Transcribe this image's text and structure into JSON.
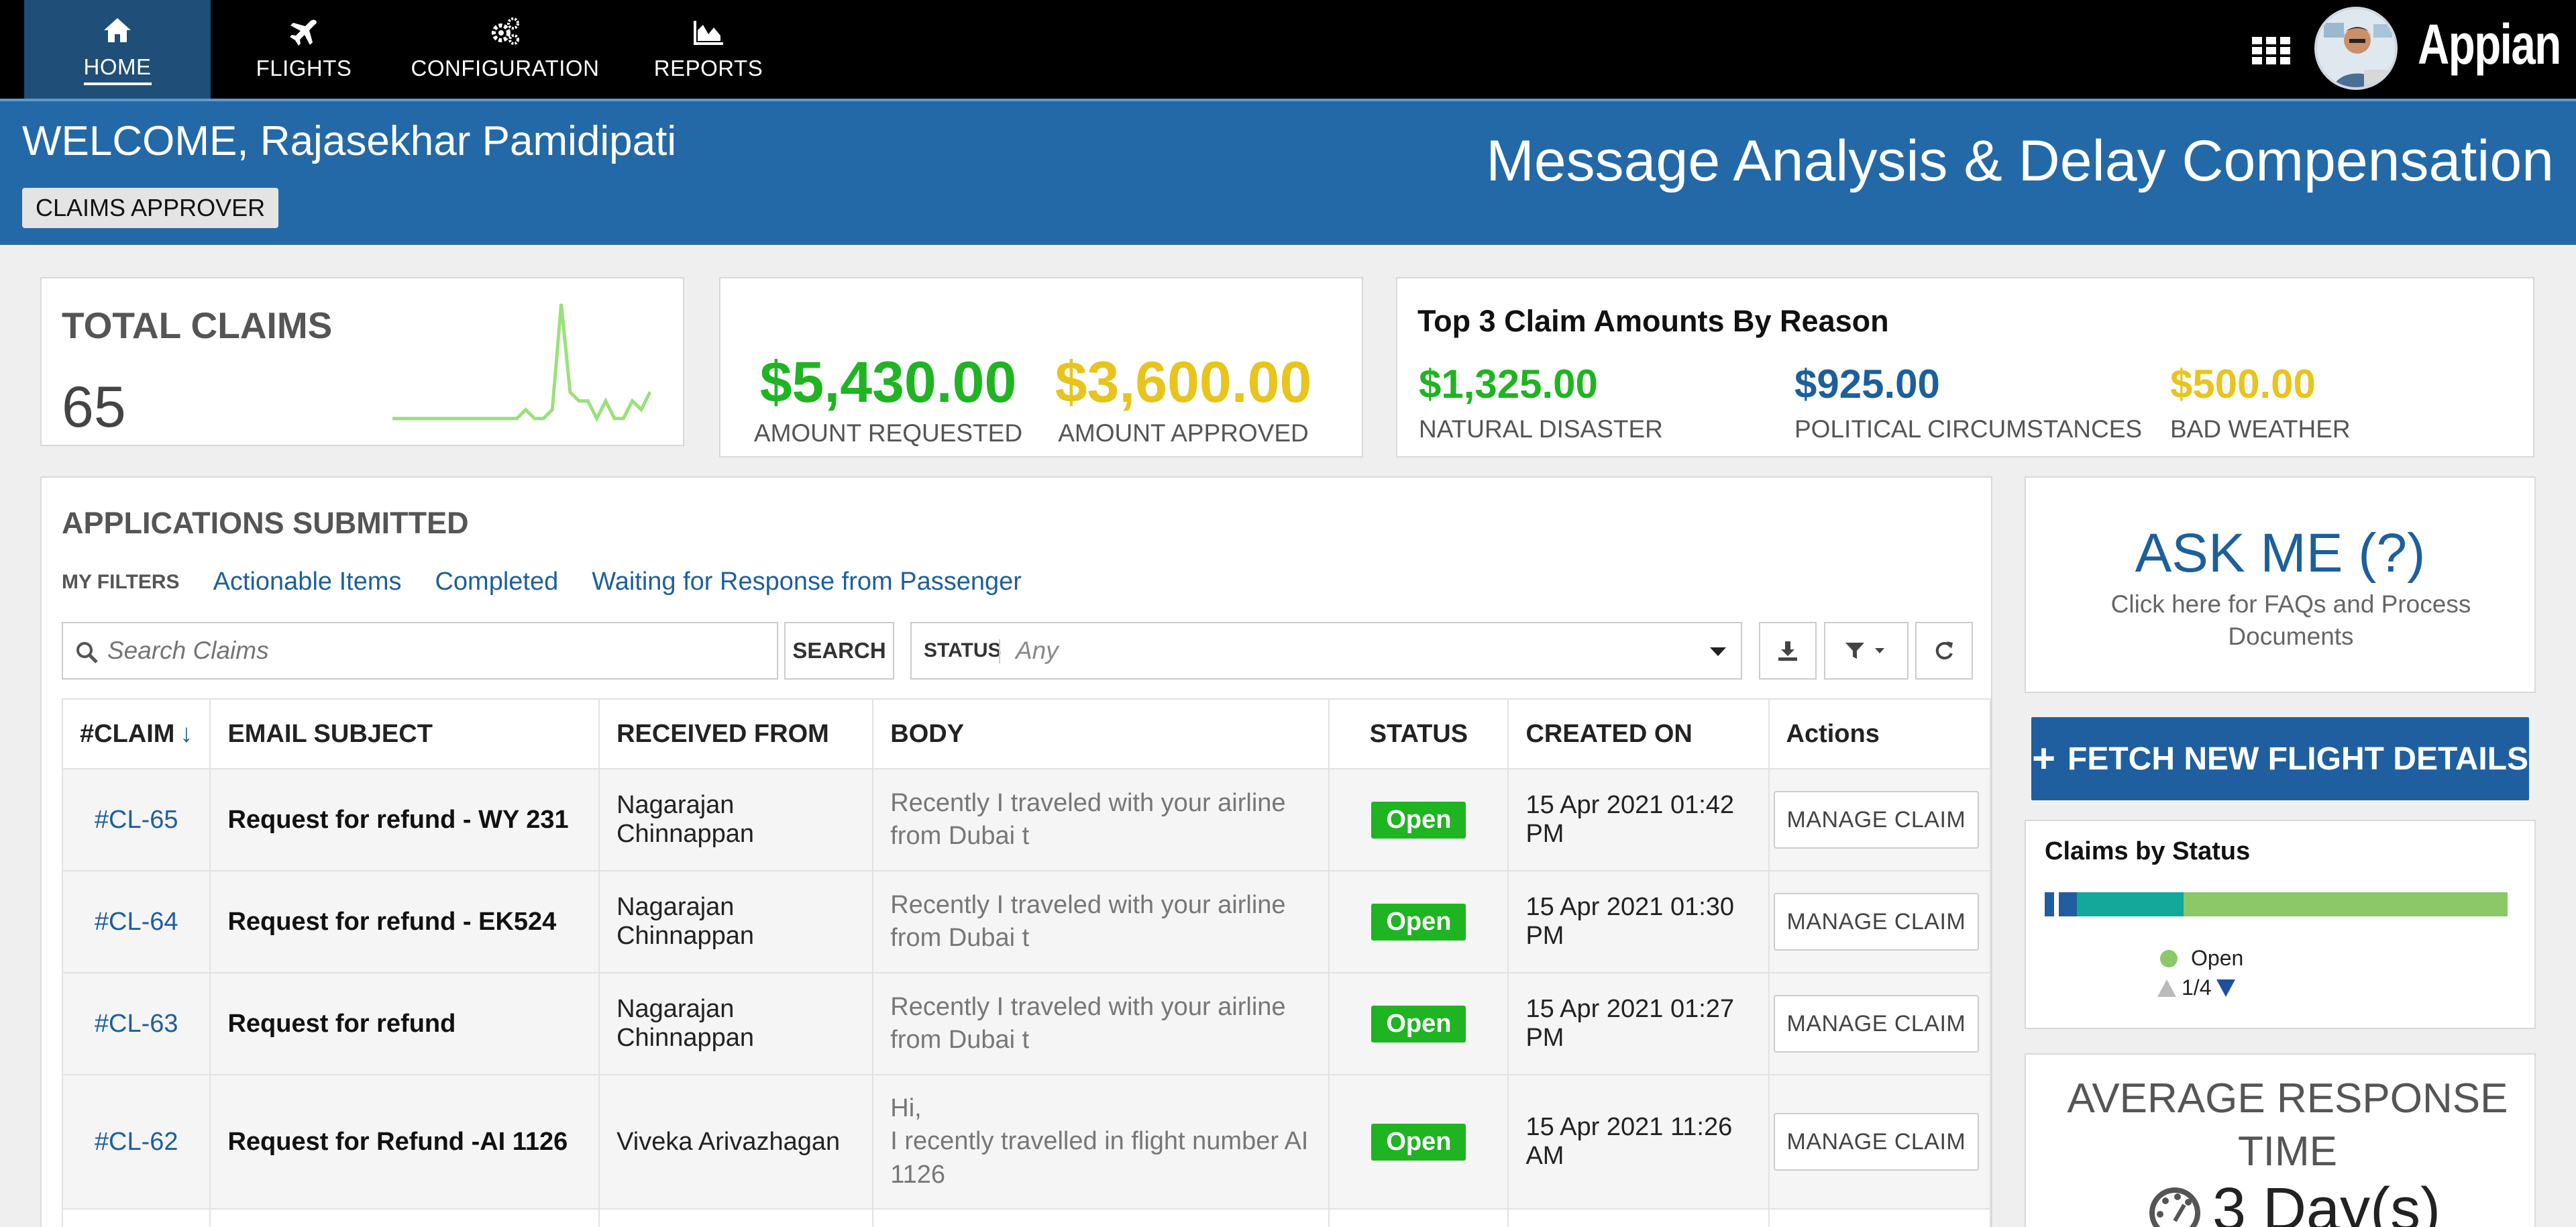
{
  "nav": {
    "items": [
      {
        "label": "HOME",
        "icon": "home-icon"
      },
      {
        "label": "FLIGHTS",
        "icon": "plane-icon"
      },
      {
        "label": "CONFIGURATION",
        "icon": "gears-icon"
      },
      {
        "label": "REPORTS",
        "icon": "area-chart-icon"
      }
    ],
    "logo": "Appian"
  },
  "banner": {
    "welcome": "WELCOME, Rajasekhar Pamidipati",
    "role": "CLAIMS APPROVER",
    "app_title": "Message Analysis & Delay Compensation"
  },
  "total_claims": {
    "label": "TOTAL CLAIMS",
    "value": "65",
    "sparkline": [
      1,
      1,
      1,
      1,
      1,
      1,
      1,
      1,
      1,
      1,
      1,
      1,
      1,
      1,
      1,
      2,
      1,
      1,
      2,
      14,
      4,
      3,
      3,
      1,
      3,
      1,
      1,
      3,
      2,
      4
    ]
  },
  "amounts": {
    "requested_value": "$5,430.00",
    "requested_label": "AMOUNT REQUESTED",
    "approved_value": "$3,600.00",
    "approved_label": "AMOUNT APPROVED"
  },
  "top3": {
    "title": "Top 3 Claim Amounts By Reason",
    "items": [
      {
        "value": "$1,325.00",
        "label": "NATURAL DISASTER",
        "color": "#1fb422"
      },
      {
        "value": "$925.00",
        "label": "POLITICAL CIRCUMSTANCES",
        "color": "#1d5f9c"
      },
      {
        "value": "$500.00",
        "label": "BAD WEATHER",
        "color": "#e8c41c"
      }
    ]
  },
  "applications": {
    "title": "APPLICATIONS SUBMITTED",
    "filters_label": "MY FILTERS",
    "filters": [
      "Actionable Items",
      "Completed",
      "Waiting for Response from Passenger"
    ],
    "search_placeholder": "Search Claims",
    "search_button": "SEARCH",
    "status_label": "STATUS",
    "status_value": "Any",
    "columns": [
      "#CLAIM",
      "EMAIL SUBJECT",
      "RECEIVED FROM",
      "BODY",
      "STATUS",
      "CREATED ON",
      "Actions"
    ],
    "sort_indicator": "↓",
    "rows": [
      {
        "id": "#CL-65",
        "subject": "Request for refund - WY 231",
        "from": "Nagarajan Chinnappan",
        "body": "Recently I traveled with your airline from Dubai t",
        "status": "Open",
        "created": "15 Apr 2021 01:42 PM",
        "action": "MANAGE CLAIM"
      },
      {
        "id": "#CL-64",
        "subject": "Request for refund - EK524",
        "from": "Nagarajan Chinnappan",
        "body": "Recently I traveled with your airline from Dubai t",
        "status": "Open",
        "created": "15 Apr 2021 01:30 PM",
        "action": "MANAGE CLAIM"
      },
      {
        "id": "#CL-63",
        "subject": "Request for refund",
        "from": "Nagarajan Chinnappan",
        "body": "Recently I traveled with your airline from Dubai t",
        "status": "Open",
        "created": "15 Apr 2021 01:27 PM",
        "action": "MANAGE CLAIM"
      },
      {
        "id": "#CL-62",
        "subject": "Request for Refund -AI 1126",
        "from": "Viveka Arivazhagan",
        "body": "Hi,\nI recently travelled in flight number AI 1126",
        "status": "Open",
        "created": "15 Apr 2021 11:26 AM",
        "action": "MANAGE CLAIM"
      }
    ]
  },
  "ask_me": {
    "title": "ASK ME (?)",
    "subtitle": "Click here for FAQs and Process Documents"
  },
  "fetch_button": "FETCH NEW FLIGHT DETAILS",
  "claims_by_status": {
    "title": "Claims by Status",
    "legend": "Open",
    "pager": "1/4",
    "segments": [
      {
        "fraction": 0.02,
        "color": "#1f5f9f"
      },
      {
        "fraction": 0.01,
        "color": "#ffffff"
      },
      {
        "fraction": 0.04,
        "color": "#1f5f9f"
      },
      {
        "fraction": 0.23,
        "color": "#12a89a"
      },
      {
        "fraction": 0.7,
        "color": "#8bc867"
      }
    ]
  },
  "avg_response": {
    "title": "AVERAGE RESPONSE TIME",
    "value": "3 Day(s)"
  },
  "colors": {
    "nav_bg": "#000000",
    "nav_active": "#1f4e79",
    "banner": "#2469a7",
    "link": "#1d5f9c",
    "green": "#1fb422",
    "yellow": "#e8c41c"
  }
}
